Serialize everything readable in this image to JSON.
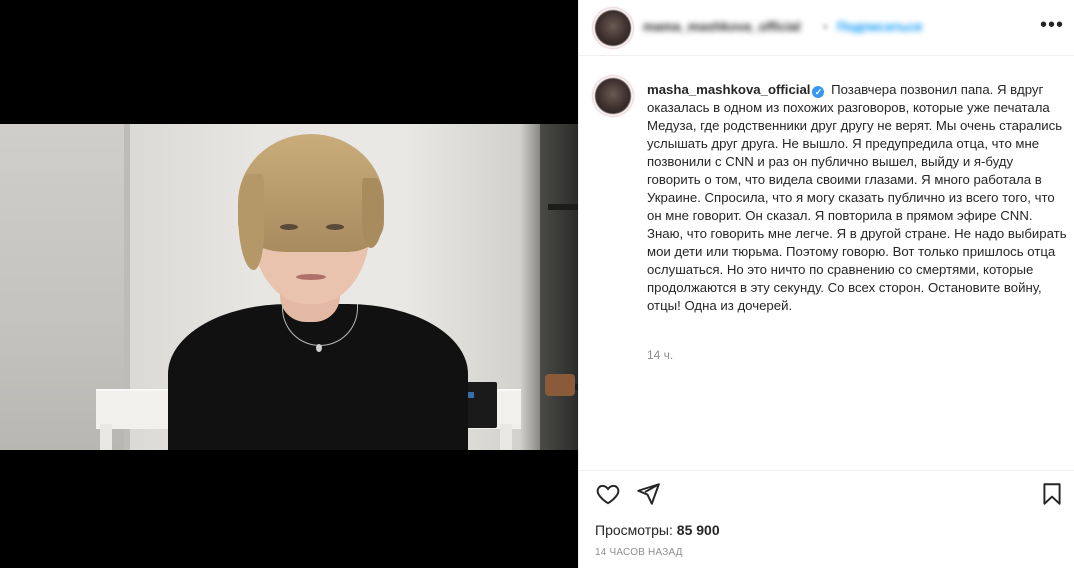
{
  "header": {
    "username_blurred": "mama_mashkova_official",
    "separator": "•",
    "follow_label": "Подписаться",
    "more_icon": "more-horizontal-icon"
  },
  "caption": {
    "username": "masha_mashkova_official",
    "verified_icon": "verified-badge-icon",
    "text": "Позавчера позвонил папа. Я вдруг оказалась в одном из похожих разговоров, которые уже печатала Медуза, где родственники друг другу не верят. Мы очень старались услышать друг друга. Не вышло. Я предупредила отца, что мне позвонили с CNN и раз он публично вышел, выйду и я-буду говорить о том, что видела своими глазами. Я много работала в Украине. Спросила, что я могу сказать публично из всего того, что он мне говорит. Он сказал. Я повторила в прямом эфире CNN.\nЗнаю, что говорить мне легче. Я в другой стране. Не надо выбирать мои дети или тюрьма. Поэтому говорю. Вот только пришлось отца ослушаться. Но это ничто по сравнению со смертями, которые продолжаются в эту секунду. Со всех сторон. Остановите войну, отцы! Одна из дочерей.",
    "time": "14 ч."
  },
  "actions": {
    "like_icon": "heart-icon",
    "share_icon": "send-icon",
    "save_icon": "bookmark-icon"
  },
  "stats": {
    "views_label": "Просмотры:",
    "views_value": "85 900",
    "posted": "14 ЧАСОВ НАЗАД"
  },
  "colors": {
    "link": "#0095f6",
    "verified": "#3897f0",
    "muted": "#8e8e8e",
    "text": "#262626"
  }
}
